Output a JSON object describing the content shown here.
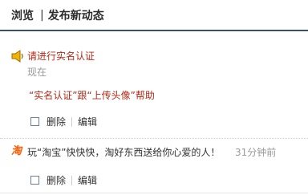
{
  "header": {
    "tab_browse": "浏览",
    "separator": "|",
    "tab_publish": "发布新动态"
  },
  "entries": [
    {
      "icon": "megaphone-icon",
      "title": "请进行实名认证",
      "time": "现在",
      "help": "“实名认证”跟“上传头像”帮助",
      "delete_label": "删除",
      "edit_label": "编辑"
    },
    {
      "icon": "taobao-icon",
      "icon_glyph": "淘",
      "text": "玩“淘宝”快快快，淘好东西送给你心爱的人！",
      "time": "31分钟前",
      "delete_label": "删除",
      "edit_label": "编辑"
    }
  ],
  "colors": {
    "accent_rule": "#3a4f73",
    "alert_red": "#b52a17",
    "muted_gray": "#9a9a9a"
  }
}
